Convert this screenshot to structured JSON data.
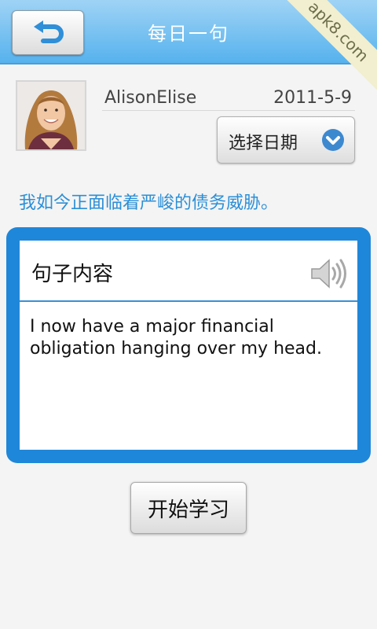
{
  "header": {
    "title": "每日一句",
    "back_icon": "undo-arrow-icon",
    "watermark": "apk8.com"
  },
  "user": {
    "name": "AlisonElise",
    "date": "2011-5-9",
    "avatar_icon": "user-photo"
  },
  "date_picker": {
    "label": "选择日期",
    "icon": "chevron-down-icon"
  },
  "sentence": {
    "chinese": "我如今正面临着严峻的债务威胁。"
  },
  "card": {
    "title": "句子内容",
    "speaker_icon": "speaker-icon",
    "english": "I now have a major financial obligation hanging over my head."
  },
  "actions": {
    "start_label": "开始学习"
  },
  "colors": {
    "header": "#56b2ee",
    "accent": "#1f87d9",
    "sentence_text": "#2b8fd7"
  }
}
